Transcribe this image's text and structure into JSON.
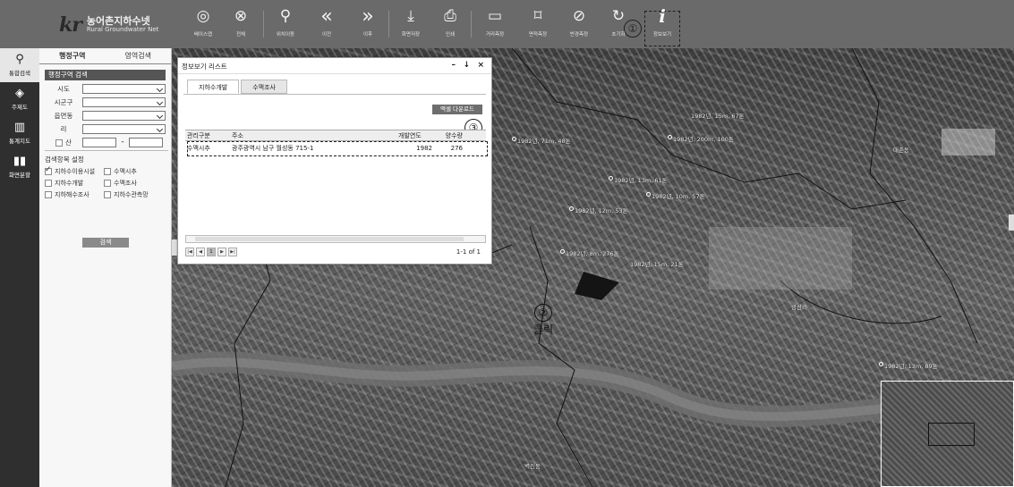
{
  "app": {
    "logo_mark": "kr",
    "name_ko": "농어촌지하수넷",
    "name_en": "Rural Groundwater Net"
  },
  "toolbar": [
    {
      "icon": "layers-icon",
      "glyph": "◎",
      "label": "베이스맵"
    },
    {
      "icon": "compass-icon",
      "glyph": "⊗",
      "label": "전체"
    },
    {
      "icon": "location-pin-icon",
      "glyph": "⚲",
      "label": "위치이동"
    },
    {
      "icon": "back-icon",
      "glyph": "«",
      "label": "이전"
    },
    {
      "icon": "forward-icon",
      "glyph": "»",
      "label": "이후"
    },
    {
      "icon": "download-icon",
      "glyph": "⤓",
      "label": "화면저장"
    },
    {
      "icon": "print-icon",
      "glyph": "⎙",
      "label": "인쇄"
    },
    {
      "icon": "ruler-icon",
      "glyph": "▭",
      "label": "거리측정"
    },
    {
      "icon": "area-icon",
      "glyph": "⌑",
      "label": "면적측정"
    },
    {
      "icon": "radius-icon",
      "glyph": "⊘",
      "label": "반경측정"
    },
    {
      "icon": "reset-icon",
      "glyph": "↻",
      "label": "초기화"
    },
    {
      "icon": "info-icon",
      "glyph": "i",
      "label": "정보보기"
    }
  ],
  "callouts": {
    "one": "①",
    "two": "②",
    "two_label": "클릭",
    "three": "③"
  },
  "rail": [
    {
      "icon": "search-icon",
      "glyph": "⚲",
      "label": "통합검색",
      "active": true
    },
    {
      "icon": "theme-map-icon",
      "glyph": "◈",
      "label": "주제도"
    },
    {
      "icon": "stats-map-icon",
      "glyph": "▥",
      "label": "통계지도"
    },
    {
      "icon": "split-screen-icon",
      "glyph": "▮▮",
      "label": "화면분할"
    }
  ],
  "search": {
    "tabs": [
      "행정구역",
      "영역검색"
    ],
    "section_title": "행정구역 검색",
    "fields": {
      "sido": "시도",
      "sigungu": "시군구",
      "eupmyeon": "읍면동",
      "ri": "리",
      "mountain": "산"
    },
    "options_title": "검색항목 설정",
    "options": [
      {
        "label": "지하수이용시설",
        "checked": true
      },
      {
        "label": "수맥시추",
        "checked": false
      },
      {
        "label": "지하수개발",
        "checked": false
      },
      {
        "label": "수맥조사",
        "checked": false
      },
      {
        "label": "지하해수조사",
        "checked": false
      },
      {
        "label": "지하수관측망",
        "checked": false
      }
    ],
    "search_button": "검색"
  },
  "window": {
    "title": "정보보기 리스트",
    "tabs": [
      "지하수개발",
      "수맥조사"
    ],
    "excel_button": "엑셀 다운로드",
    "columns": [
      "관리구분",
      "주소",
      "개발연도",
      "양수량"
    ],
    "rows": [
      {
        "type": "수맥시추",
        "address": "광주광역시 남구 월성동 715-1",
        "year": "1982",
        "yield": "276"
      }
    ],
    "pager": {
      "current": "1",
      "info": "1-1 of 1"
    }
  },
  "map_labels": [
    "1982년, 71m, 48톤",
    "1982년, 200m, 100톤",
    "1982년, 15m, 67톤",
    "1982년, 13m, 61톤",
    "1982년, 10m, 57톤",
    "1982년, 12m, 53톤",
    "1982년, 8m, 276톤",
    "1982년, 15m, 21톤",
    "1982년, 13m, 89톤",
    "대촌동",
    "벽진동",
    "광산리"
  ]
}
